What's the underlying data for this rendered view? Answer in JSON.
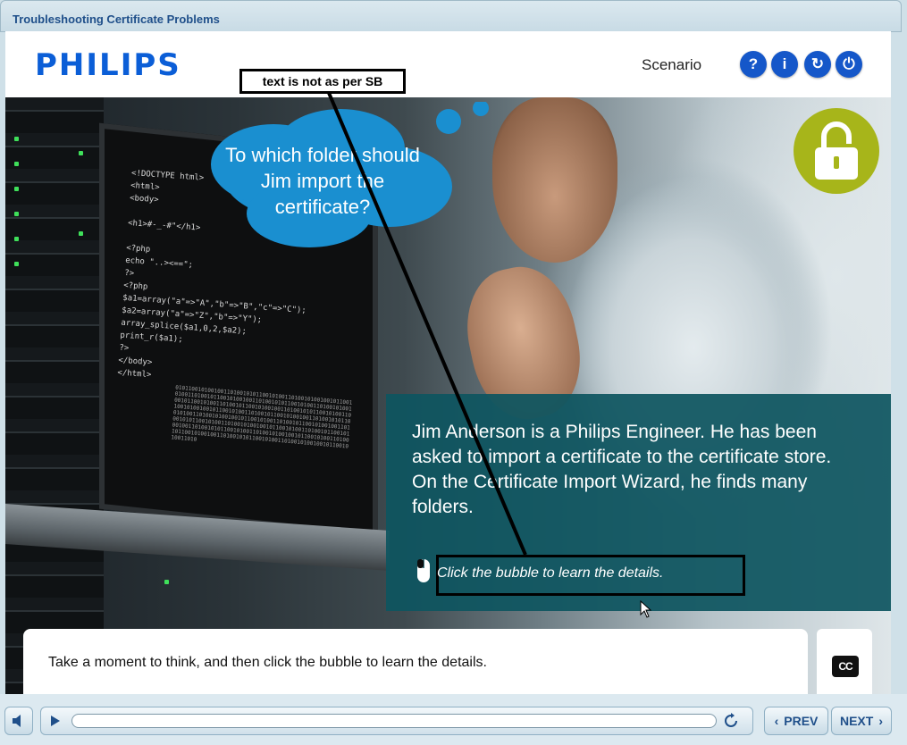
{
  "window": {
    "title": "Troubleshooting Certificate Problems"
  },
  "header": {
    "logo": "PHILIPS",
    "section": "Scenario",
    "buttons": [
      {
        "name": "help",
        "glyph": "?"
      },
      {
        "name": "info",
        "glyph": "i"
      },
      {
        "name": "replay",
        "glyph": "↻"
      },
      {
        "name": "exit",
        "glyph": "⏻"
      }
    ]
  },
  "scene": {
    "bubble_text": "To which folder should Jim import the certificate?",
    "code_lines": "<!DOCTYPE html>\n<html>\n<body>\n\n<h1>#-_-#\"</h1>\n\n<?php\necho \"..><==\";\n?>\n<?php\n$a1=array(\"a\"=>\"A\",\"b\"=>\"B\",\"c\"=>\"C\");\n$a2=array(\"a\"=>\"Z\",\"b\"=>\"Y\");\narray_splice($a1,0,2,$a2);\nprint_r($a1);\n?>\n</body>\n</html>",
    "binary": "0101100101001001101001010110010100110100101001001011001010011010010110010100100110100101011001010011010010100100101100101001101001011001010010011010010101100101001101001010010010110010100110100101100101001001101001010110010100110100101001001011001010011010010110010100100110100101011001010011010010100100101100101001101001011001010010011010010101100101001101001010010010110010100110100101100101001001101001010110010100110100101001001011001010011010",
    "panel_text": "Jim Anderson is a Philips Engineer. He has been asked to import a certificate to the certificate store. On the Certificate Import Wizard, he finds many folders.",
    "hint": "Click the bubble to learn the details.",
    "review_note": "text is not as per SB"
  },
  "caption": {
    "text": "Take a moment to think, and then click the bubble to learn the details."
  },
  "cc_label": "CC",
  "player": {
    "prev_label": "PREV",
    "next_label": "NEXT",
    "progress": 0.0
  },
  "colors": {
    "brand": "#0b5ed7",
    "header_button": "#1557c9",
    "bubble": "#1a8fd0",
    "panel": "#0e5560",
    "lock": "#a7b51a"
  }
}
